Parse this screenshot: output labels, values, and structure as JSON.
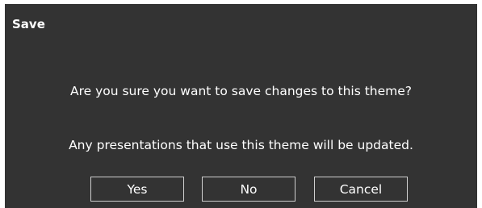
{
  "dialog": {
    "title": "Save",
    "message_line1": "Are you sure you want to save changes to this theme?",
    "message_line2": "Any presentations that use this theme will be updated."
  },
  "buttons": {
    "yes_label": "Yes",
    "no_label": "No",
    "cancel_label": "Cancel"
  },
  "colors": {
    "background": "#333333",
    "text": "#ffffff",
    "button_border": "#cfcfcf"
  }
}
